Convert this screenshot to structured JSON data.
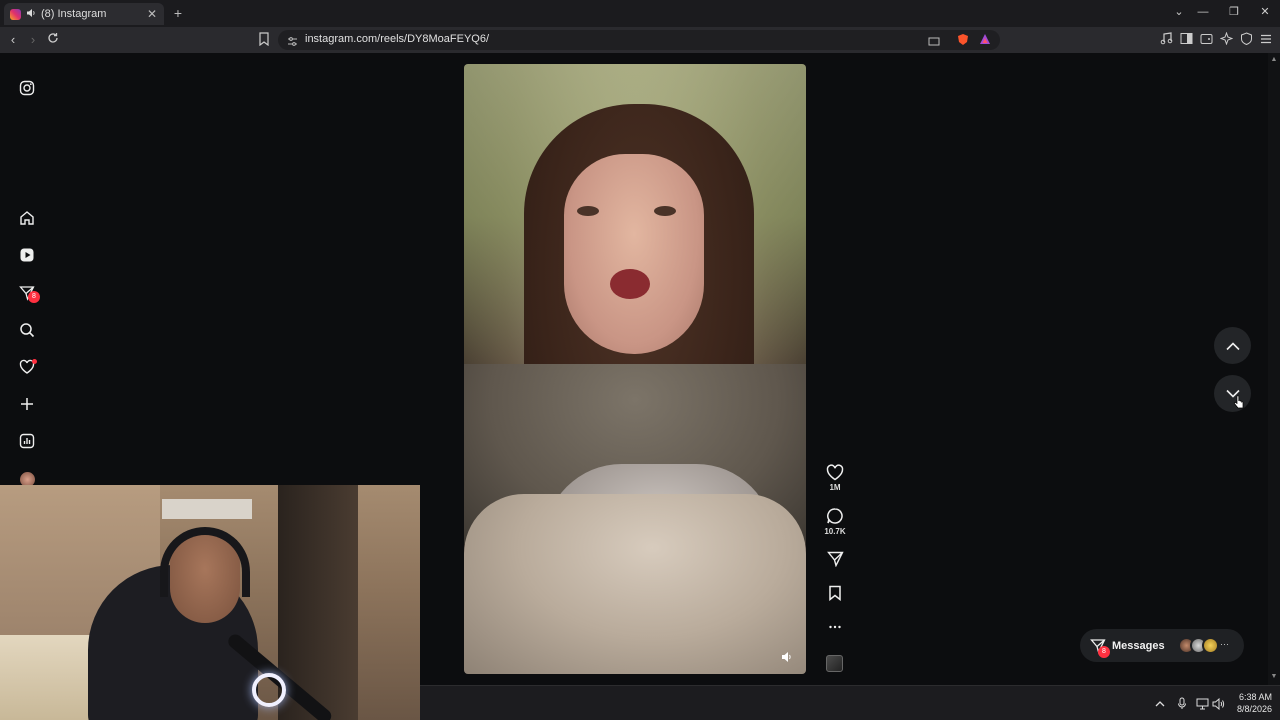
{
  "browser": {
    "tab_title": "(8) Instagram",
    "new_tab_label": "+",
    "url": "instagram.com/reels/DY8MoaFEYQ6/"
  },
  "sidebar": {
    "items": [
      {
        "name": "instagram-logo-icon"
      },
      {
        "name": "home-icon"
      },
      {
        "name": "reels-icon"
      },
      {
        "name": "messages-icon",
        "badge": "8"
      },
      {
        "name": "search-icon"
      },
      {
        "name": "notifications-icon"
      },
      {
        "name": "create-icon"
      },
      {
        "name": "dashboard-icon"
      },
      {
        "name": "profile-avatar"
      }
    ]
  },
  "reel": {
    "like_count": "1M",
    "comment_count": "10.7K"
  },
  "messages": {
    "label": "Messages",
    "badge": "8",
    "more": "···"
  },
  "taskbar": {
    "time": "6:38 AM",
    "date": "8/8/2026"
  },
  "colors": {
    "accent_badge": "#ff3040",
    "page_bg": "#0c0d0f"
  }
}
